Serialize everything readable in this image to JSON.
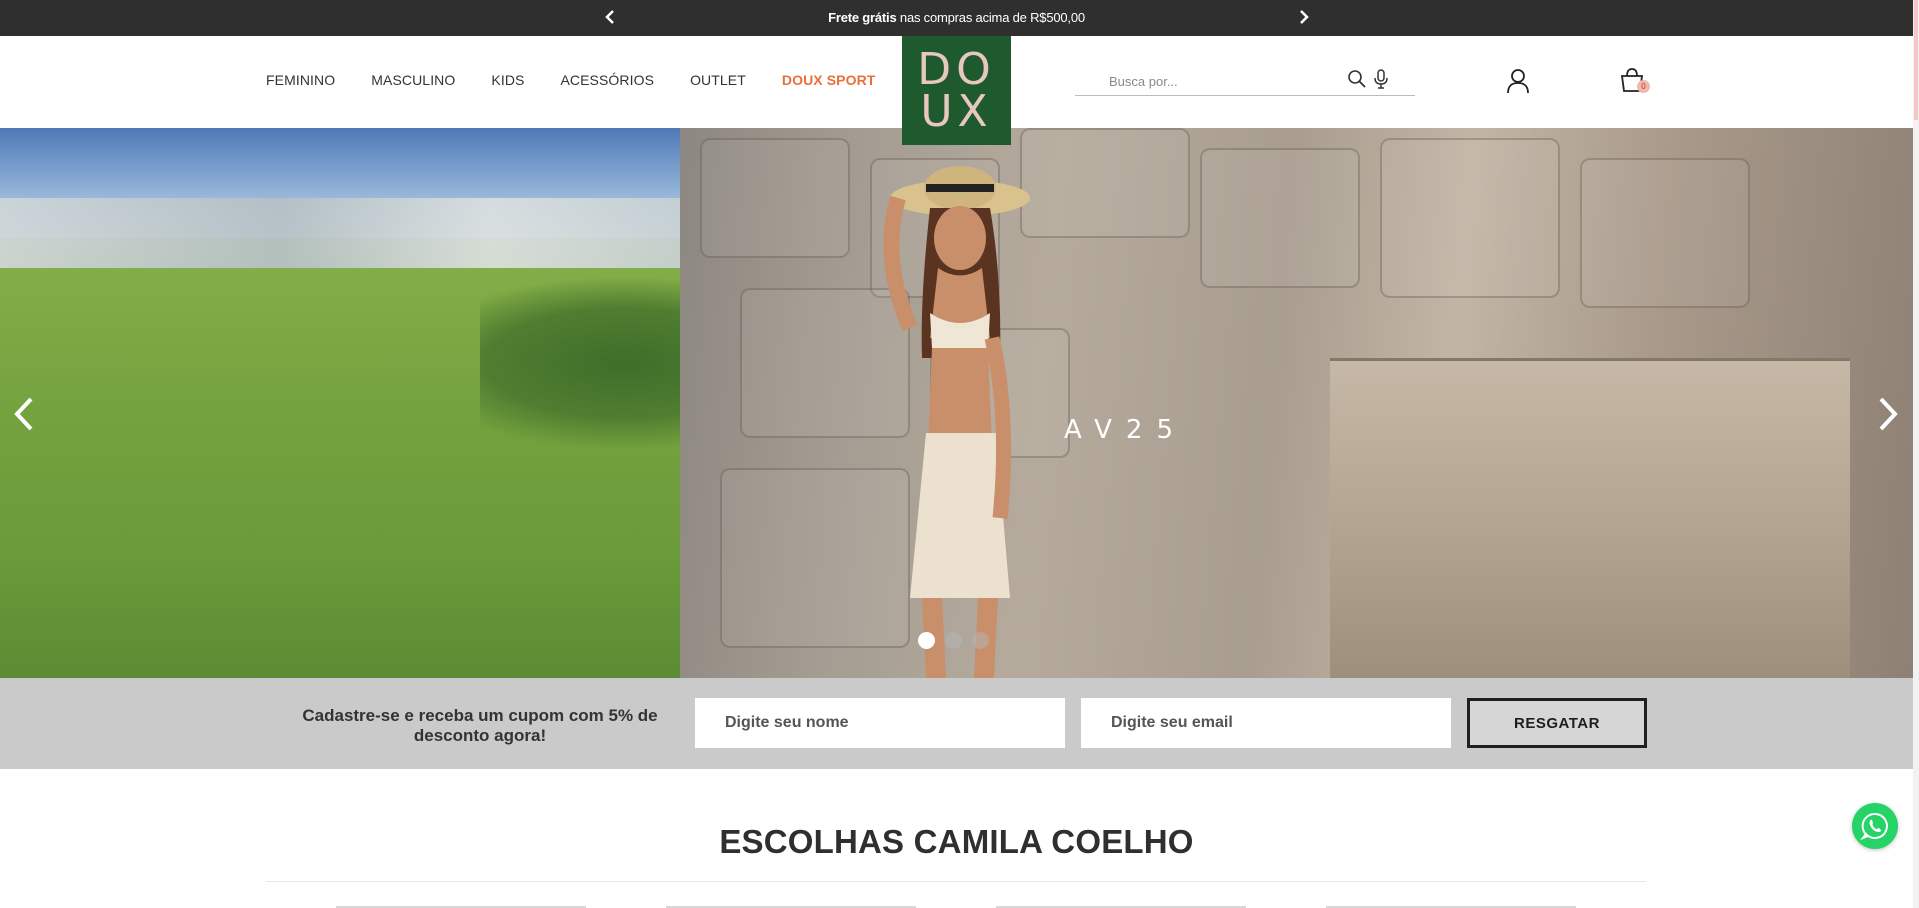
{
  "topbar": {
    "bold": "Frete grátis",
    "rest": " nas compras acima de R$500,00"
  },
  "nav": {
    "items": [
      "FEMININO",
      "MASCULINO",
      "KIDS",
      "ACESSÓRIOS",
      "OUTLET",
      "DOUX SPORT"
    ]
  },
  "logo": {
    "line1": "DO",
    "line2": "UX"
  },
  "search": {
    "placeholder": "Busca por..."
  },
  "cart": {
    "count": "0"
  },
  "hero": {
    "overlay": "AV25",
    "active_slide": 1,
    "slide_count": 3
  },
  "signup": {
    "text": "Cadastre-se e receba um cupom com 5% de desconto agora!",
    "name_placeholder": "Digite seu nome",
    "email_placeholder": "Digite seu email",
    "button": "RESGATAR"
  },
  "section": {
    "title": "ESCOLHAS CAMILA COELHO"
  },
  "colors": {
    "topbar_bg": "#2f2f2f",
    "logo_bg": "#1f5a2f",
    "logo_text": "#e7c7bf",
    "sport_accent": "#e8703a",
    "signup_bg": "#cacaca",
    "whatsapp": "#25d366"
  }
}
